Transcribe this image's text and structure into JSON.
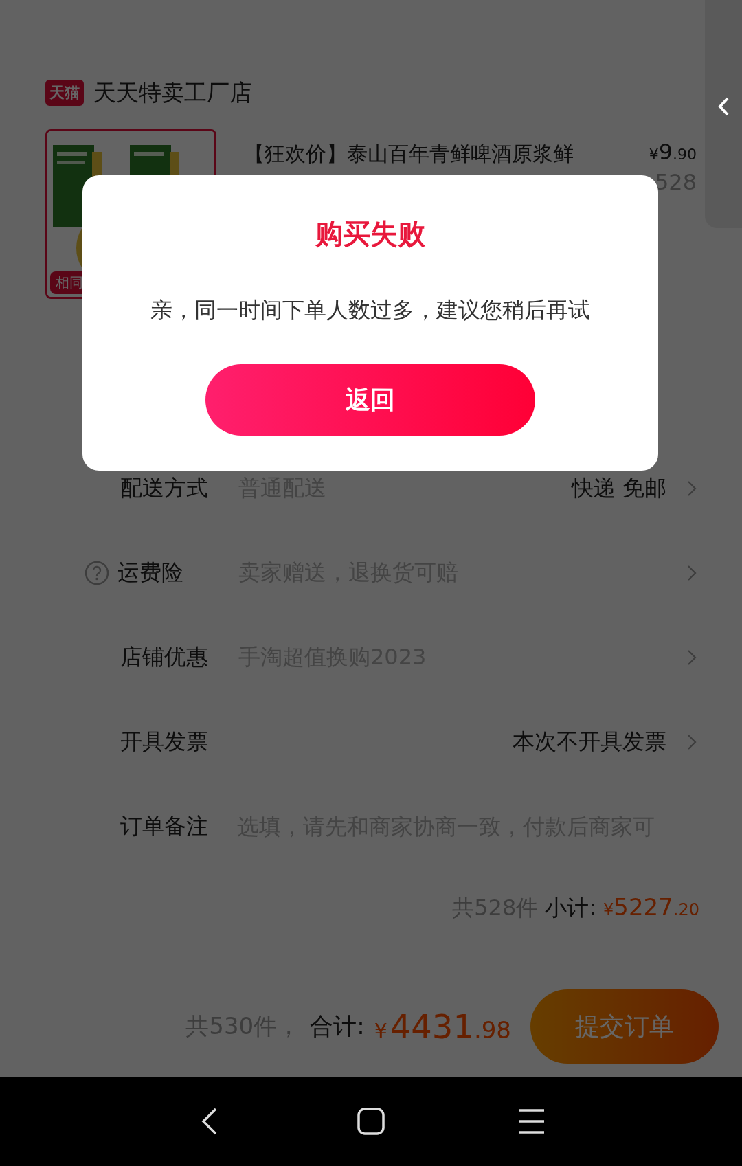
{
  "store": {
    "badge": "天猫",
    "name": "天天特卖工厂店"
  },
  "product": {
    "tag": "相同",
    "title": "【狂欢价】泰山百年青鲜啤酒原浆鲜",
    "currency": "¥",
    "price_int": "9",
    "price_dec": ".90",
    "quantity": "528"
  },
  "rows": [
    {
      "kind": "select",
      "label": "配送方式",
      "help": false,
      "value": "普通配送",
      "right_value": "快递 免邮"
    },
    {
      "kind": "select",
      "label": "运费险",
      "help": true,
      "value": "卖家赠送，退换货可赔"
    },
    {
      "kind": "select",
      "label": "店铺优惠",
      "help": false,
      "value": "手淘超值换购2023"
    },
    {
      "kind": "select",
      "label": "开具发票",
      "help": false,
      "right_value": "本次不开具发票"
    },
    {
      "kind": "note",
      "label": "订单备注",
      "help": false,
      "placeholder": "选填，请先和商家协商一致，付款后商家可"
    }
  ],
  "subtotal": {
    "count": "共528件",
    "label": "小计:",
    "currency": "¥",
    "amount_int": "5227",
    "amount_dec": ".20"
  },
  "footer": {
    "count": "共530件，",
    "label": "合计:",
    "currency": "¥",
    "amount_int": "4431",
    "amount_dec": ".98",
    "submit": "提交订单"
  },
  "dialog": {
    "title": "购买失败",
    "message": "亲，同一时间下单人数过多，建议您稍后再试",
    "button": "返回"
  }
}
